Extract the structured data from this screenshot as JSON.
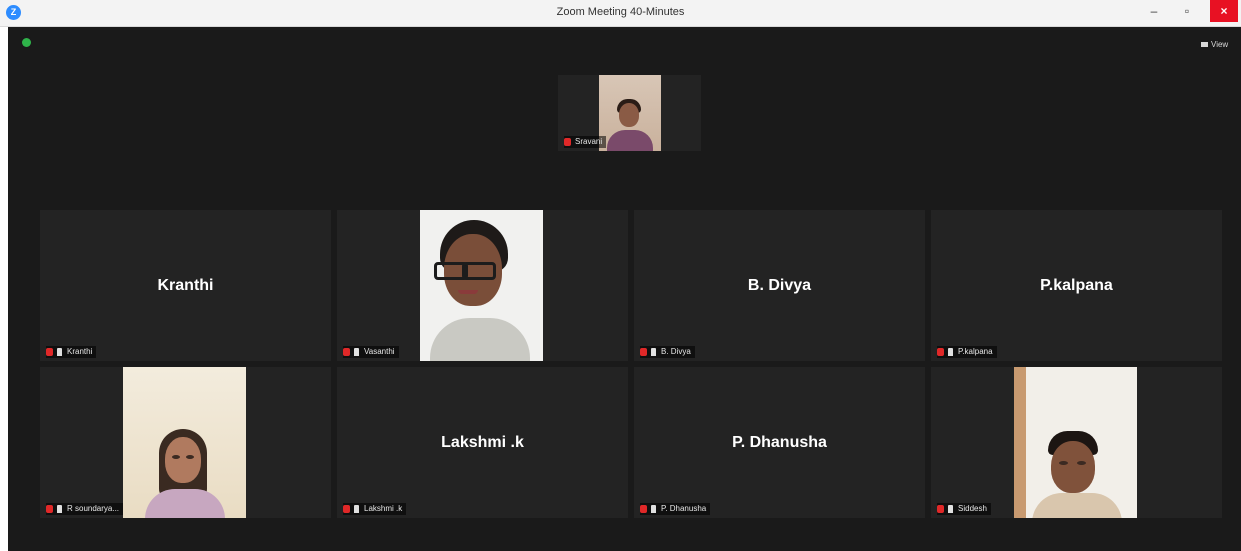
{
  "window": {
    "title": "Zoom Meeting 40-Minutes",
    "app_icon_text": "Z",
    "minimize_glyph": "–",
    "maximize_glyph": "▫",
    "close_glyph": "×"
  },
  "meeting": {
    "view_label": "View",
    "status_icon": "connection-ok-icon"
  },
  "active_speaker": {
    "label": "Sravani"
  },
  "participants": [
    {
      "name": "Kranthi",
      "label": "Kranthi",
      "video": false
    },
    {
      "name": "",
      "label": "Vasanthi",
      "video": true
    },
    {
      "name": "B. Divya",
      "label": "B. Divya",
      "video": false
    },
    {
      "name": "P.kalpana",
      "label": "P.kalpana",
      "video": false
    },
    {
      "name": "",
      "label": "R soundarya...",
      "video": true
    },
    {
      "name": "Lakshmi .k",
      "label": "Lakshmi .k",
      "video": false
    },
    {
      "name": "P. Dhanusha",
      "label": "P. Dhanusha",
      "video": false
    },
    {
      "name": "",
      "label": "Siddesh",
      "video": true
    }
  ],
  "colors": {
    "stage_bg": "#1a1a1a",
    "tile_bg": "#232323",
    "muted_icon": "#e02828",
    "close_button": "#e81123",
    "status_green": "#2fb34a"
  }
}
